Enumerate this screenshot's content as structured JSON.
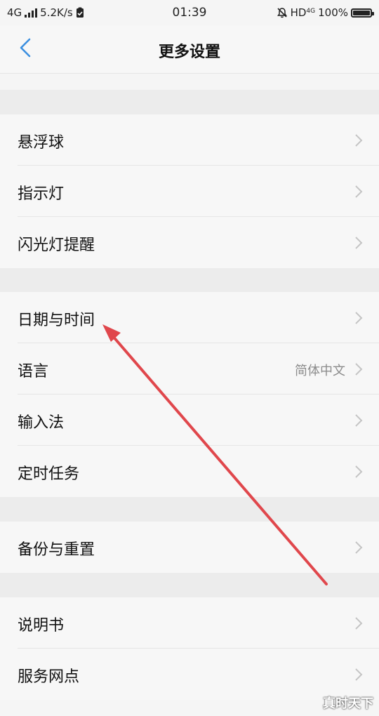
{
  "status": {
    "network": "4G",
    "speed": "5.2K/s",
    "time": "01:39",
    "hd": "HD",
    "net_sup": "4G",
    "battery_pct": "100%"
  },
  "header": {
    "title": "更多设置",
    "back_icon": "chevron-left-icon"
  },
  "accent_color": "#3b8fe0",
  "annotation_arrow_color": "#e0474c",
  "groups": [
    {
      "items": [
        {
          "label": "悬浮球"
        },
        {
          "label": "指示灯"
        },
        {
          "label": "闪光灯提醒"
        }
      ]
    },
    {
      "items": [
        {
          "label": "日期与时间"
        },
        {
          "label": "语言",
          "value": "简体中文"
        },
        {
          "label": "输入法"
        },
        {
          "label": "定时任务"
        }
      ]
    },
    {
      "items": [
        {
          "label": "备份与重置"
        }
      ]
    },
    {
      "items": [
        {
          "label": "说明书"
        },
        {
          "label": "服务网点"
        }
      ]
    }
  ],
  "watermark": "真时天下"
}
